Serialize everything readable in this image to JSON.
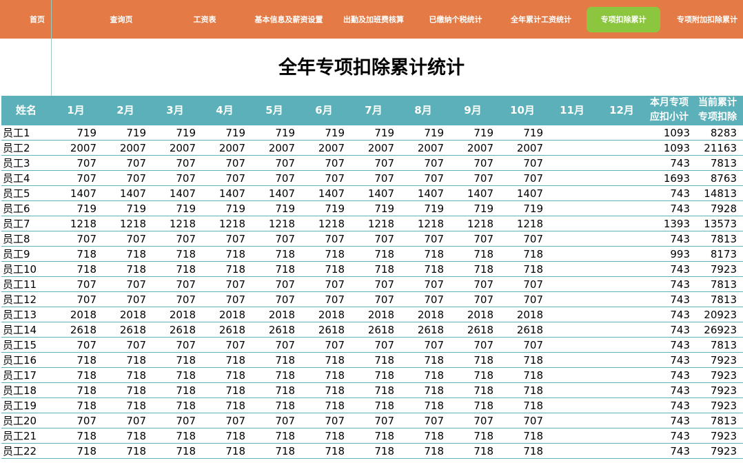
{
  "nav": {
    "items": [
      {
        "label": "首页"
      },
      {
        "label": "查询页"
      },
      {
        "label": "工资表"
      },
      {
        "label": "基本信息及薪资设置"
      },
      {
        "label": "出勤及加班费核算"
      },
      {
        "label": "已缴纳个税统计"
      },
      {
        "label": "全年累计工资统计"
      },
      {
        "label": "专项扣除累计",
        "active": true
      },
      {
        "label": "专项附加扣除累计"
      }
    ]
  },
  "title": "全年专项扣除累计统计",
  "table": {
    "headers": {
      "name": "姓名",
      "months": [
        "1月",
        "2月",
        "3月",
        "4月",
        "5月",
        "6月",
        "7月",
        "8月",
        "9月",
        "10月",
        "11月",
        "12月"
      ],
      "subtotal": [
        "本月专项",
        "应扣小计"
      ],
      "cumulative": [
        "当前累计",
        "专项扣除"
      ]
    },
    "rows": [
      {
        "name": "员工1",
        "months": [
          719,
          719,
          719,
          719,
          719,
          719,
          719,
          719,
          719,
          719,
          "",
          ""
        ],
        "subtotal": 1093,
        "cumulative": 8283
      },
      {
        "name": "员工2",
        "months": [
          2007,
          2007,
          2007,
          2007,
          2007,
          2007,
          2007,
          2007,
          2007,
          2007,
          "",
          ""
        ],
        "subtotal": 1093,
        "cumulative": 21163
      },
      {
        "name": "员工3",
        "months": [
          707,
          707,
          707,
          707,
          707,
          707,
          707,
          707,
          707,
          707,
          "",
          ""
        ],
        "subtotal": 743,
        "cumulative": 7813
      },
      {
        "name": "员工4",
        "months": [
          707,
          707,
          707,
          707,
          707,
          707,
          707,
          707,
          707,
          707,
          "",
          ""
        ],
        "subtotal": 1693,
        "cumulative": 8763
      },
      {
        "name": "员工5",
        "months": [
          1407,
          1407,
          1407,
          1407,
          1407,
          1407,
          1407,
          1407,
          1407,
          1407,
          "",
          ""
        ],
        "subtotal": 743,
        "cumulative": 14813
      },
      {
        "name": "员工6",
        "months": [
          719,
          719,
          719,
          719,
          719,
          719,
          719,
          719,
          719,
          719,
          "",
          ""
        ],
        "subtotal": 743,
        "cumulative": 7928
      },
      {
        "name": "员工7",
        "months": [
          1218,
          1218,
          1218,
          1218,
          1218,
          1218,
          1218,
          1218,
          1218,
          1218,
          "",
          ""
        ],
        "subtotal": 1393,
        "cumulative": 13573
      },
      {
        "name": "员工8",
        "months": [
          707,
          707,
          707,
          707,
          707,
          707,
          707,
          707,
          707,
          707,
          "",
          ""
        ],
        "subtotal": 743,
        "cumulative": 7813
      },
      {
        "name": "员工9",
        "months": [
          718,
          718,
          718,
          718,
          718,
          718,
          718,
          718,
          718,
          718,
          "",
          ""
        ],
        "subtotal": 993,
        "cumulative": 8173
      },
      {
        "name": "员工10",
        "months": [
          718,
          718,
          718,
          718,
          718,
          718,
          718,
          718,
          718,
          718,
          "",
          ""
        ],
        "subtotal": 743,
        "cumulative": 7923
      },
      {
        "name": "员工11",
        "months": [
          707,
          707,
          707,
          707,
          707,
          707,
          707,
          707,
          707,
          707,
          "",
          ""
        ],
        "subtotal": 743,
        "cumulative": 7813
      },
      {
        "name": "员工12",
        "months": [
          707,
          707,
          707,
          707,
          707,
          707,
          707,
          707,
          707,
          707,
          "",
          ""
        ],
        "subtotal": 743,
        "cumulative": 7813
      },
      {
        "name": "员工13",
        "months": [
          2018,
          2018,
          2018,
          2018,
          2018,
          2018,
          2018,
          2018,
          2018,
          2018,
          "",
          ""
        ],
        "subtotal": 743,
        "cumulative": 20923
      },
      {
        "name": "员工14",
        "months": [
          2618,
          2618,
          2618,
          2618,
          2618,
          2618,
          2618,
          2618,
          2618,
          2618,
          "",
          ""
        ],
        "subtotal": 743,
        "cumulative": 26923
      },
      {
        "name": "员工15",
        "months": [
          707,
          707,
          707,
          707,
          707,
          707,
          707,
          707,
          707,
          707,
          "",
          ""
        ],
        "subtotal": 743,
        "cumulative": 7813
      },
      {
        "name": "员工16",
        "months": [
          718,
          718,
          718,
          718,
          718,
          718,
          718,
          718,
          718,
          718,
          "",
          ""
        ],
        "subtotal": 743,
        "cumulative": 7923
      },
      {
        "name": "员工17",
        "months": [
          718,
          718,
          718,
          718,
          718,
          718,
          718,
          718,
          718,
          718,
          "",
          ""
        ],
        "subtotal": 743,
        "cumulative": 7923
      },
      {
        "name": "员工18",
        "months": [
          718,
          718,
          718,
          718,
          718,
          718,
          718,
          718,
          718,
          718,
          "",
          ""
        ],
        "subtotal": 743,
        "cumulative": 7923
      },
      {
        "name": "员工19",
        "months": [
          718,
          718,
          718,
          718,
          718,
          718,
          718,
          718,
          718,
          718,
          "",
          ""
        ],
        "subtotal": 743,
        "cumulative": 7923
      },
      {
        "name": "员工20",
        "months": [
          707,
          707,
          707,
          707,
          707,
          707,
          707,
          707,
          707,
          707,
          "",
          ""
        ],
        "subtotal": 743,
        "cumulative": 7813
      },
      {
        "name": "员工21",
        "months": [
          718,
          718,
          718,
          718,
          718,
          718,
          718,
          718,
          718,
          718,
          "",
          ""
        ],
        "subtotal": 743,
        "cumulative": 7923
      },
      {
        "name": "员工22",
        "months": [
          718,
          718,
          718,
          718,
          718,
          718,
          718,
          718,
          718,
          718,
          "",
          ""
        ],
        "subtotal": 743,
        "cumulative": 7923
      }
    ]
  }
}
